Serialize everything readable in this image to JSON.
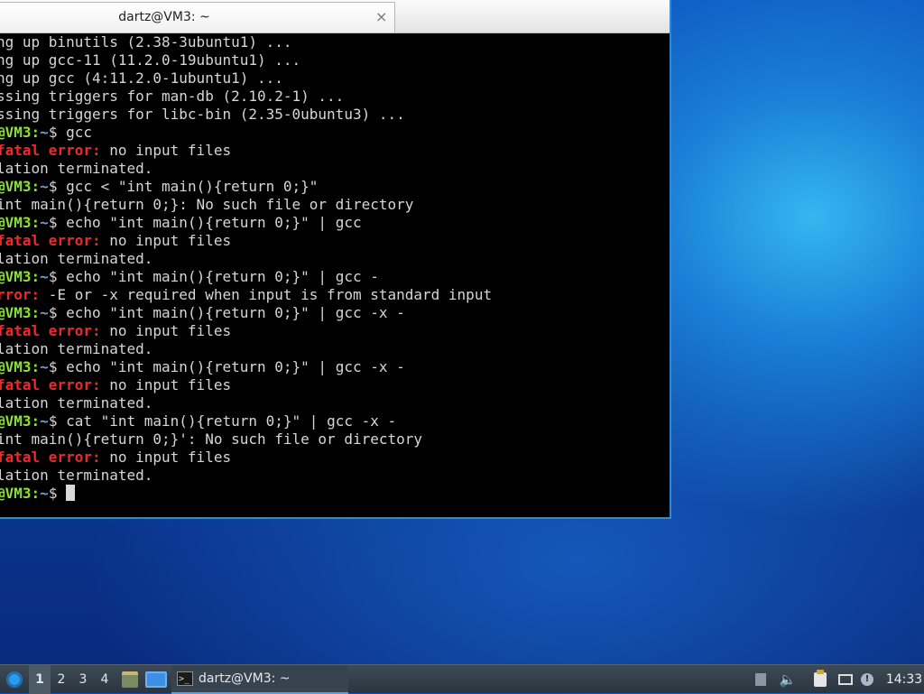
{
  "window": {
    "tab_title": "dartz@VM3: ~",
    "close_glyph": "×"
  },
  "terminal": {
    "lines": [
      [
        {
          "t": "ng up binutils (2.38-3ubuntu1) ..."
        }
      ],
      [
        {
          "t": "ng up gcc-11 (11.2.0-19ubuntu1) ..."
        }
      ],
      [
        {
          "t": "ng up gcc (4:11.2.0-1ubuntu1) ..."
        }
      ],
      [
        {
          "t": "ssing triggers for man-db (2.10.2-1) ..."
        }
      ],
      [
        {
          "t": "ssing triggers for libc-bin (2.35-0ubuntu3) ..."
        }
      ],
      [
        {
          "t": "@VM3",
          "c": "g"
        },
        {
          "t": ":",
          "c": "g"
        },
        {
          "t": "~",
          "c": "b"
        },
        {
          "t": "$ gcc"
        }
      ],
      [
        {
          "t": "fatal error:",
          "c": "r"
        },
        {
          "t": " no input files"
        }
      ],
      [
        {
          "t": "lation terminated."
        }
      ],
      [
        {
          "t": "@VM3",
          "c": "g"
        },
        {
          "t": ":",
          "c": "g"
        },
        {
          "t": "~",
          "c": "b"
        },
        {
          "t": "$ gcc < \"int main(){return 0;}\""
        }
      ],
      [
        {
          "t": "int main(){return 0;}: No such file or directory"
        }
      ],
      [
        {
          "t": "@VM3",
          "c": "g"
        },
        {
          "t": ":",
          "c": "g"
        },
        {
          "t": "~",
          "c": "b"
        },
        {
          "t": "$ echo \"int main(){return 0;}\" | gcc"
        }
      ],
      [
        {
          "t": "fatal error:",
          "c": "r"
        },
        {
          "t": " no input files"
        }
      ],
      [
        {
          "t": "lation terminated."
        }
      ],
      [
        {
          "t": "@VM3",
          "c": "g"
        },
        {
          "t": ":",
          "c": "g"
        },
        {
          "t": "~",
          "c": "b"
        },
        {
          "t": "$ echo \"int main(){return 0;}\" | gcc -"
        }
      ],
      [
        {
          "t": "rror:",
          "c": "r"
        },
        {
          "t": " -E or -x required when input is from standard input"
        }
      ],
      [
        {
          "t": "@VM3",
          "c": "g"
        },
        {
          "t": ":",
          "c": "g"
        },
        {
          "t": "~",
          "c": "b"
        },
        {
          "t": "$ echo \"int main(){return 0;}\" | gcc -x -"
        }
      ],
      [
        {
          "t": "fatal error:",
          "c": "r"
        },
        {
          "t": " no input files"
        }
      ],
      [
        {
          "t": "lation terminated."
        }
      ],
      [
        {
          "t": "@VM3",
          "c": "g"
        },
        {
          "t": ":",
          "c": "g"
        },
        {
          "t": "~",
          "c": "b"
        },
        {
          "t": "$ echo \"int main(){return 0;}\" | gcc -x -"
        }
      ],
      [
        {
          "t": "fatal error:",
          "c": "r"
        },
        {
          "t": " no input files"
        }
      ],
      [
        {
          "t": "lation terminated."
        }
      ],
      [
        {
          "t": "@VM3",
          "c": "g"
        },
        {
          "t": ":",
          "c": "g"
        },
        {
          "t": "~",
          "c": "b"
        },
        {
          "t": "$ cat \"int main(){return 0;}\" | gcc -x -"
        }
      ],
      [
        {
          "t": "int main(){return 0;}': No such file or directory"
        }
      ],
      [
        {
          "t": "fatal error:",
          "c": "r"
        },
        {
          "t": " no input files"
        }
      ],
      [
        {
          "t": "lation terminated."
        }
      ],
      [
        {
          "t": "@VM3",
          "c": "g"
        },
        {
          "t": ":",
          "c": "g"
        },
        {
          "t": "~",
          "c": "b"
        },
        {
          "t": "$ "
        }
      ]
    ],
    "colors": {
      "background": "#000000",
      "prompt_user": "#8ae234",
      "prompt_path": "#729fcf",
      "error": "#ef2929",
      "text": "#d6d6d6"
    }
  },
  "taskbar": {
    "workspaces": [
      "1",
      "2",
      "3",
      "4"
    ],
    "active_workspace": "1",
    "task_label": "dartz@VM3: ~",
    "volume_glyph": "🔈",
    "clock": "14:33",
    "icons": {
      "start": "distro-logo-icon",
      "files": "file-manager-icon",
      "show_desktop": "show-desktop-icon",
      "task": "terminal-icon",
      "tray_expand": "tray-expand-icon",
      "volume": "speaker-icon",
      "clipboard": "clipboard-icon",
      "network": "network-icon",
      "updates": "update-notifier-icon"
    }
  }
}
